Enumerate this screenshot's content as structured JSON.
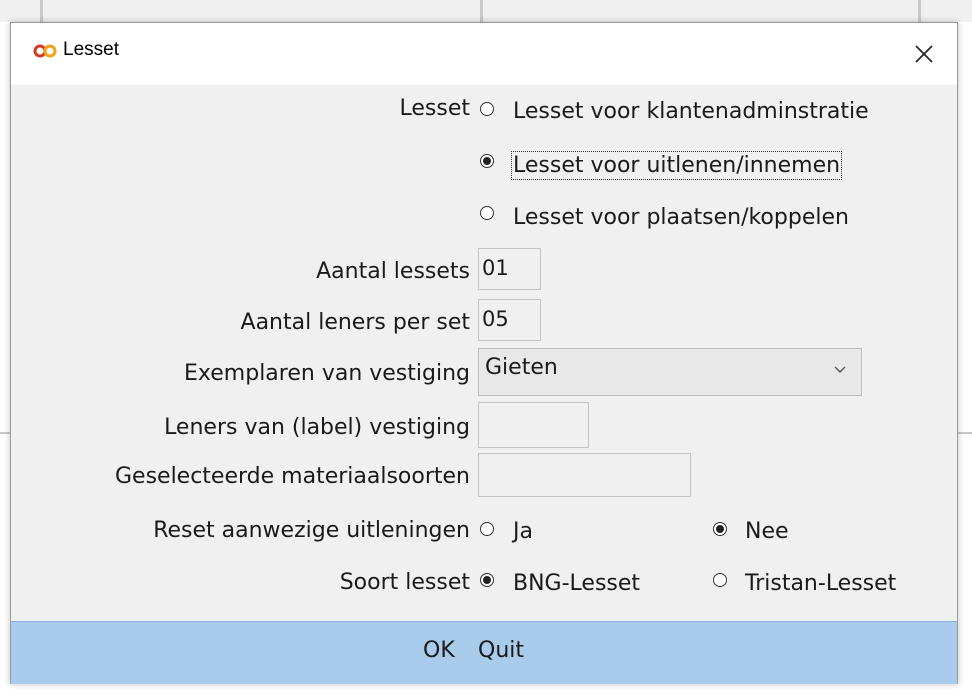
{
  "window": {
    "title": "Lesset",
    "close_icon": "close-icon",
    "app_icon": "infinity-icon"
  },
  "form": {
    "lesset_label": "Lesset",
    "lesset_options": [
      {
        "label": "Lesset voor klantenadminstratie",
        "checked": false
      },
      {
        "label": "Lesset voor uitlenen/innemen",
        "checked": true
      },
      {
        "label": "Lesset voor plaatsen/koppelen",
        "checked": false
      }
    ],
    "aantal_lessets_label": "Aantal lessets",
    "aantal_lessets_value": "01",
    "aantal_leners_label": "Aantal leners per set",
    "aantal_leners_value": "05",
    "exemplaren_label": "Exemplaren van vestiging",
    "exemplaren_value": "Gieten",
    "leners_vestiging_label": "Leners van (label) vestiging",
    "leners_vestiging_value": "",
    "materiaalsoorten_label": "Geselecteerde materiaalsoorten",
    "materiaalsoorten_value": "",
    "reset_label": "Reset aanwezige uitleningen",
    "reset_options": [
      {
        "label": "Ja",
        "checked": false
      },
      {
        "label": "Nee",
        "checked": true
      }
    ],
    "soort_label": "Soort lesset",
    "soort_options": [
      {
        "label": "BNG-Lesset",
        "checked": true
      },
      {
        "label": "Tristan-Lesset",
        "checked": false
      }
    ]
  },
  "footer": {
    "ok_label": "OK",
    "quit_label": "Quit"
  },
  "colors": {
    "footer_bg": "#a9cbec",
    "dialog_bg": "#f0f0f0"
  }
}
